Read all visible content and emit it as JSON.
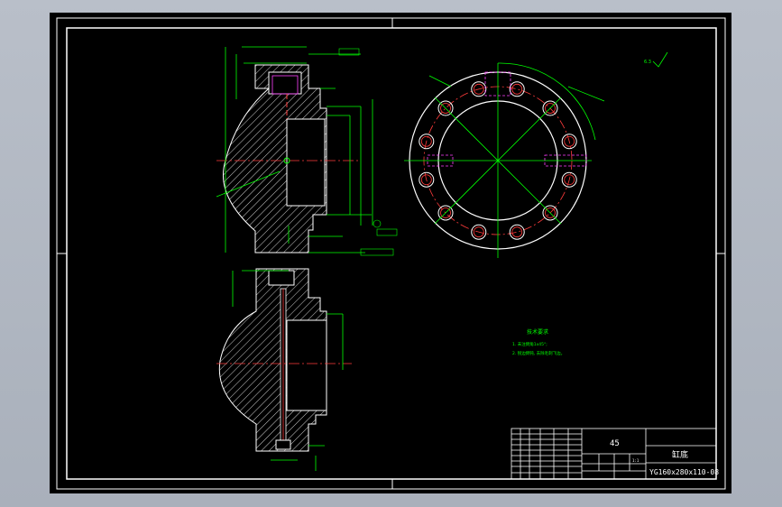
{
  "title_block": {
    "material": "45",
    "part_name": "缸底",
    "drawing_number": "YG160x280x110-08",
    "scale": "1:1",
    "small_labels": [
      "标记",
      "处数",
      "分区",
      "更改文件号",
      "签名",
      "年、月、日",
      "设计",
      "标准化",
      "审核",
      "工艺",
      "批准",
      "阶段标记",
      "重量",
      "比例",
      "共 张",
      "第 张"
    ]
  },
  "technical_requirements": {
    "heading": "技术要求",
    "items": [
      "1. 未注倒角1x45°;",
      "2. 锐边倒钝, 去除毛刺飞边。"
    ]
  },
  "surface_finish_note": "6.3",
  "colors": {
    "background": "#000000",
    "outline": "#ffffff",
    "dimension": "#00ff00",
    "centerline": "#ff3b3b",
    "hidden": "#ff40ff",
    "hatch": "#ffffff"
  }
}
